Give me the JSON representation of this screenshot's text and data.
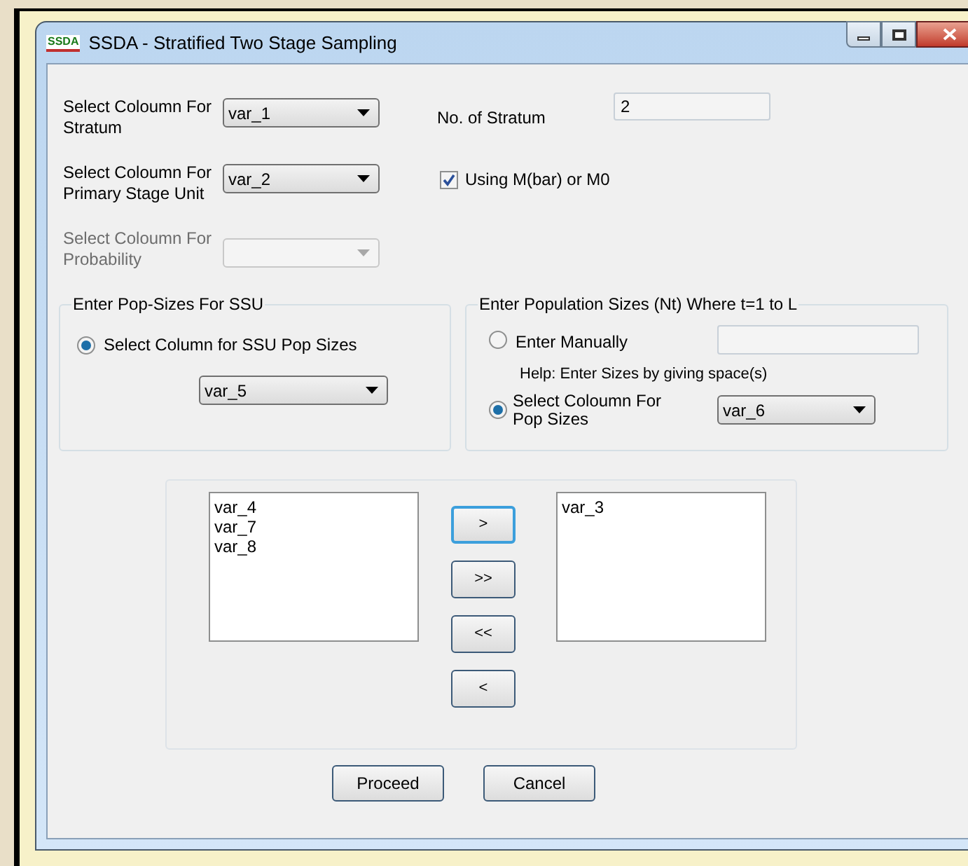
{
  "window": {
    "title": "SSDA - Stratified Two Stage Sampling",
    "app_icon": "SSDA"
  },
  "column_selectors": [
    {
      "label": "Select Coloumn For Stratum",
      "value": "var_1",
      "disabled": false
    },
    {
      "label": "Select Coloumn For Primary Stage Unit",
      "value": "var_2",
      "disabled": false
    },
    {
      "label": "Select Coloumn For Probability",
      "disabled": true
    }
  ],
  "stratum": {
    "label": "No. of Stratum",
    "value": "2"
  },
  "using_mbar": {
    "label": "Using M(bar) or M0",
    "checked": true
  },
  "ssu_group": {
    "title": "Enter Pop-Sizes For SSU",
    "option": {
      "label": "Select Column for SSU Pop Sizes",
      "selected": true
    },
    "value": "var_5"
  },
  "population_group": {
    "title": "Enter Population Sizes (Nt) Where t=1 to L",
    "options": [
      {
        "kind": "manual",
        "label": "Enter Manually",
        "selected": false
      },
      {
        "kind": "column",
        "label": "Select Coloumn For Pop Sizes",
        "selected": true,
        "value": "var_6"
      }
    ],
    "help": "Help: Enter Sizes by giving space(s)"
  },
  "available_list": [
    "var_4",
    "var_7",
    "var_8"
  ],
  "selected_list": [
    "var_3"
  ],
  "move_buttons": [
    {
      "label": ">",
      "focused": true
    },
    {
      "label": ">>",
      "focused": false
    },
    {
      "label": "<<",
      "focused": false
    },
    {
      "label": "<",
      "focused": false
    }
  ],
  "actions": [
    {
      "label": "Proceed"
    },
    {
      "label": "Cancel"
    }
  ]
}
